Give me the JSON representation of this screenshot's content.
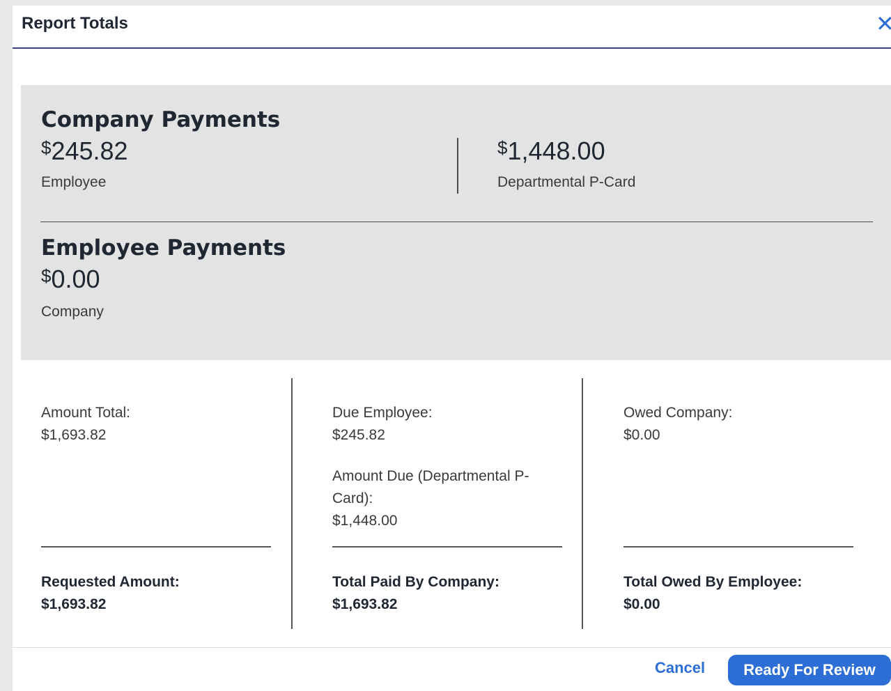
{
  "dialog": {
    "title": "Report Totals",
    "close_icon": "close-icon"
  },
  "company_payments": {
    "heading": "Company Payments",
    "items": [
      {
        "currency": "$",
        "amount": "245.82",
        "label": "Employee"
      },
      {
        "currency": "$",
        "amount": "1,448.00",
        "label": "Departmental P-Card"
      }
    ]
  },
  "employee_payments": {
    "heading": "Employee Payments",
    "item": {
      "currency": "$",
      "amount": "0.00",
      "label": "Company"
    }
  },
  "columns": [
    {
      "lines": [
        {
          "label": "Amount Total:",
          "value": "$1,693.82"
        }
      ],
      "total_label": "Requested Amount:",
      "total_value": "$1,693.82"
    },
    {
      "lines": [
        {
          "label": "Due Employee:",
          "value": "$245.82"
        },
        {
          "label": "Amount Due (Departmental P-Card):",
          "value": "$1,448.00"
        }
      ],
      "total_label": "Total Paid By Company:",
      "total_value": "$1,693.82"
    },
    {
      "lines": [
        {
          "label": "Owed Company:",
          "value": "$0.00"
        }
      ],
      "total_label": "Total Owed By Employee:",
      "total_value": "$0.00"
    }
  ],
  "footer": {
    "cancel_label": "Cancel",
    "primary_label": "Ready For Review"
  },
  "colors": {
    "accent": "#2c6ed5",
    "summary_bg": "#e3e3e3",
    "header_rule": "#3b3f8c"
  }
}
